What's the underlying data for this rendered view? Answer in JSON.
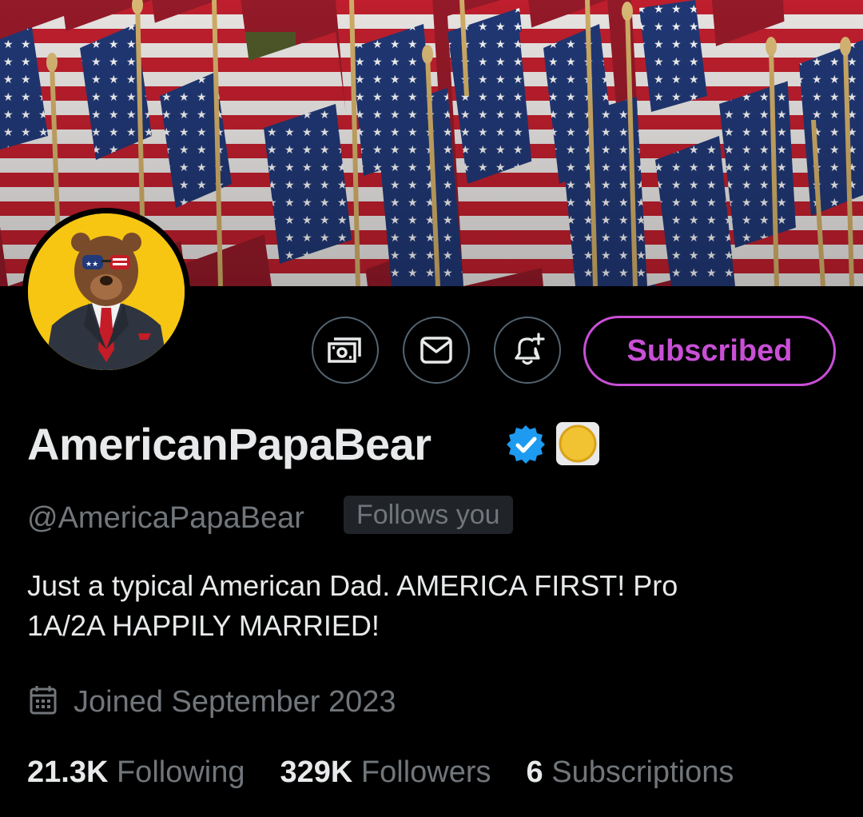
{
  "profile": {
    "display_name": "AmericanPapaBear",
    "handle": "@AmericaPapaBear",
    "follows_you": "Follows you",
    "bio_line1": "Just a typical American Dad. AMERICA FIRST! Pro",
    "bio_line2": "1A/2A HAPPILY MARRIED!",
    "joined": "Joined September 2023"
  },
  "actions": {
    "subscribed_label": "Subscribed",
    "money_icon": "money-icon",
    "mail_icon": "mail-icon",
    "bell_icon": "bell-plus-icon"
  },
  "stats": {
    "following_count": "21.3K",
    "following_label": "Following",
    "followers_count": "329K",
    "followers_label": "Followers",
    "subscriptions_count": "6",
    "subscriptions_label": "Subscriptions"
  },
  "colors": {
    "background": "#000000",
    "text_primary": "#e7e9ea",
    "text_secondary": "#71767b",
    "subscribed_accent": "#c94fd6",
    "verified_blue": "#1d9bf0",
    "avatar_bg": "#f6c613"
  }
}
